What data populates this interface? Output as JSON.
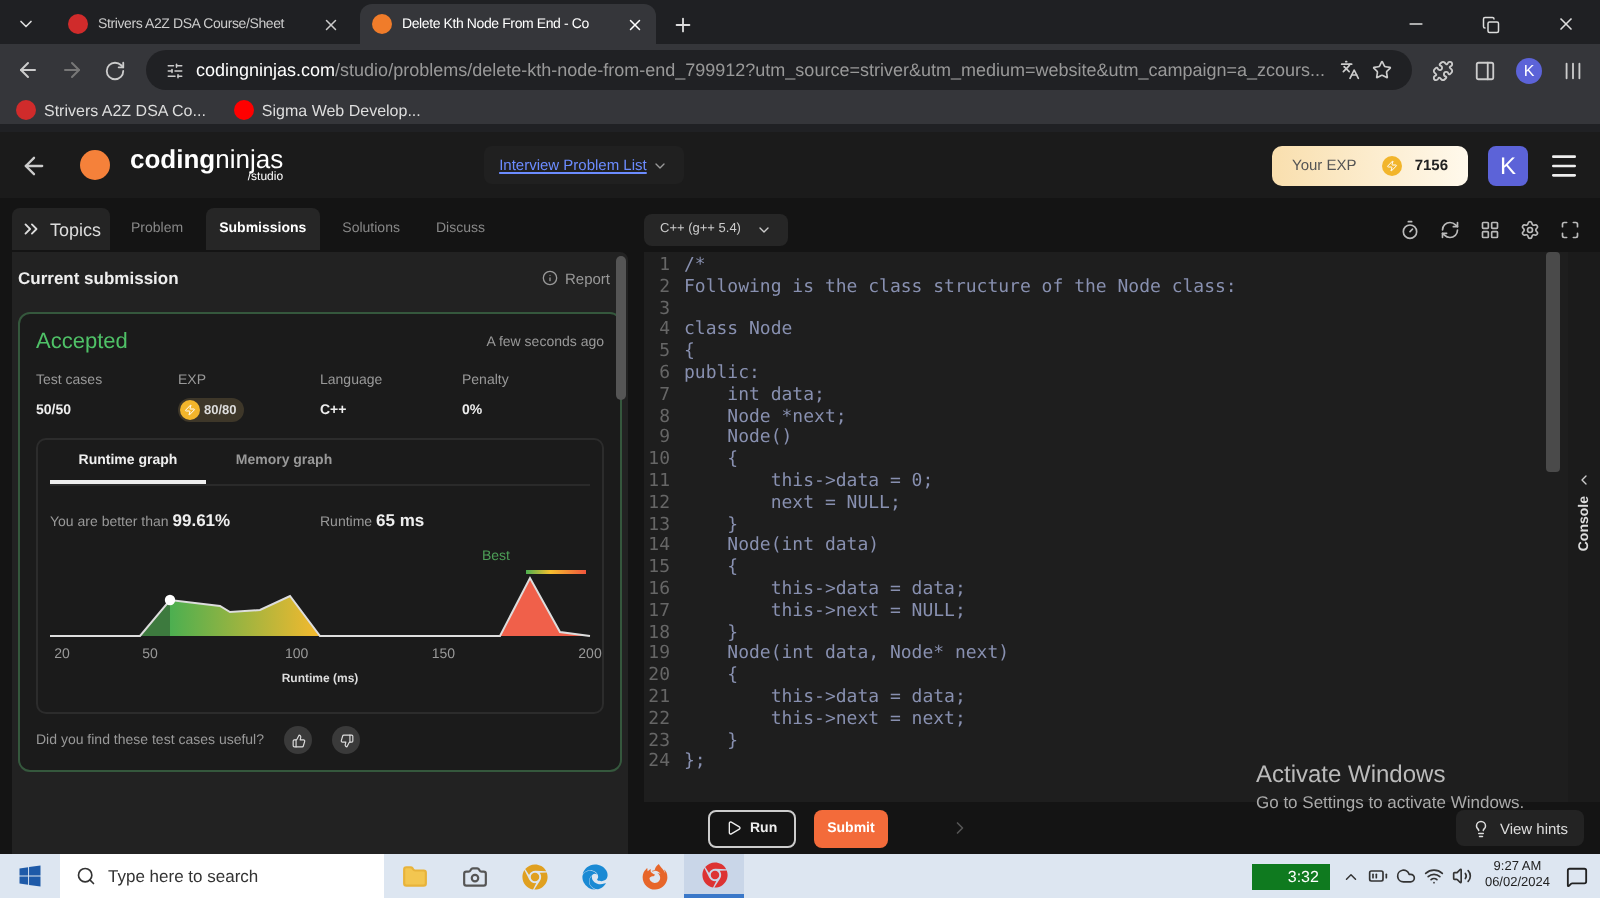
{
  "browser": {
    "tabs": [
      {
        "title": "Strivers A2Z DSA Course/Sheet",
        "selected": false
      },
      {
        "title": "Delete Kth Node From End - Co",
        "selected": true
      }
    ],
    "url_host": "codingninjas.com",
    "url_path": "/studio/problems/delete-kth-node-from-end_799912?utm_source=striver&utm_medium=website&utm_campaign=a_zcours...",
    "bookmarks": [
      "Strivers A2Z DSA Co...",
      "Sigma Web Develop..."
    ],
    "profile": "K"
  },
  "header": {
    "logo_main": "coding",
    "logo_accent": "ninjas",
    "logo_sub": "/studio",
    "link": "Interview Problem List",
    "exp_label": "Your EXP",
    "exp_value": "7156",
    "avatar": "K"
  },
  "left": {
    "topics": "Topics",
    "tabs": [
      {
        "label": "Problem",
        "selected": false
      },
      {
        "label": "Submissions",
        "selected": true
      },
      {
        "label": "Solutions",
        "selected": false
      },
      {
        "label": "Discuss",
        "selected": false
      }
    ],
    "title": "Current submission",
    "report": "Report",
    "card": {
      "status": "Accepted",
      "time": "A few seconds ago",
      "stats": [
        {
          "label": "Test cases",
          "value": "50/50",
          "kind": "text"
        },
        {
          "label": "EXP",
          "value": "80/80",
          "kind": "exp"
        },
        {
          "label": "Language",
          "value": "C++",
          "kind": "text"
        },
        {
          "label": "Penalty",
          "value": "0%",
          "kind": "text"
        }
      ],
      "graph_tabs": [
        {
          "label": "Runtime graph",
          "selected": true
        },
        {
          "label": "Memory graph",
          "selected": false
        }
      ],
      "better_label": "You are better than",
      "better_value": "99.61%",
      "runtime_label": "Runtime",
      "runtime_value": "65 ms",
      "best_label": "Best",
      "x_ticks": [
        "20",
        "50",
        "100",
        "150",
        "200"
      ],
      "x_label": "Runtime (ms)"
    },
    "feedback": "Did you find these test cases useful?"
  },
  "editor": {
    "language": "C++ (g++ 5.4)",
    "lines": [
      {
        "number": "1",
        "text": "/*"
      },
      {
        "number": "2",
        "text": "Following is the class structure of the Node class:"
      },
      {
        "number": "3"
      },
      {
        "number": "4",
        "text": "class Node"
      },
      {
        "number": "5",
        "text": "{"
      },
      {
        "number": "6",
        "text": "public:"
      },
      {
        "number": "7",
        "text": "    int data;"
      },
      {
        "number": "8",
        "text": "    Node *next;"
      },
      {
        "number": "9",
        "text": "    Node()"
      },
      {
        "number": "10",
        "text": "    {"
      },
      {
        "number": "11",
        "text": "        this->data = 0;"
      },
      {
        "number": "12",
        "text": "        next = NULL;"
      },
      {
        "number": "13",
        "text": "    }"
      },
      {
        "number": "14",
        "text": "    Node(int data)"
      },
      {
        "number": "15",
        "text": "    {"
      },
      {
        "number": "16",
        "text": "        this->data = data;"
      },
      {
        "number": "17",
        "text": "        this->next = NULL;"
      },
      {
        "number": "18",
        "text": "    }"
      },
      {
        "number": "19",
        "text": "    Node(int data, Node* next)"
      },
      {
        "number": "20",
        "text": "    {"
      },
      {
        "number": "21",
        "text": "        this->data = data;"
      },
      {
        "number": "22",
        "text": "        this->next = next;"
      },
      {
        "number": "23",
        "text": "    }"
      },
      {
        "number": "24",
        "text": "};"
      }
    ],
    "console": "Console",
    "run": "Run",
    "submit": "Submit",
    "hints": "View hints"
  },
  "activation": {
    "title": "Activate Windows",
    "subtitle": "Go to Settings to activate Windows."
  },
  "taskbar": {
    "search_placeholder": "Type here to search",
    "battery": "3:32",
    "time": "9:27 AM",
    "date": "06/02/2024"
  }
}
